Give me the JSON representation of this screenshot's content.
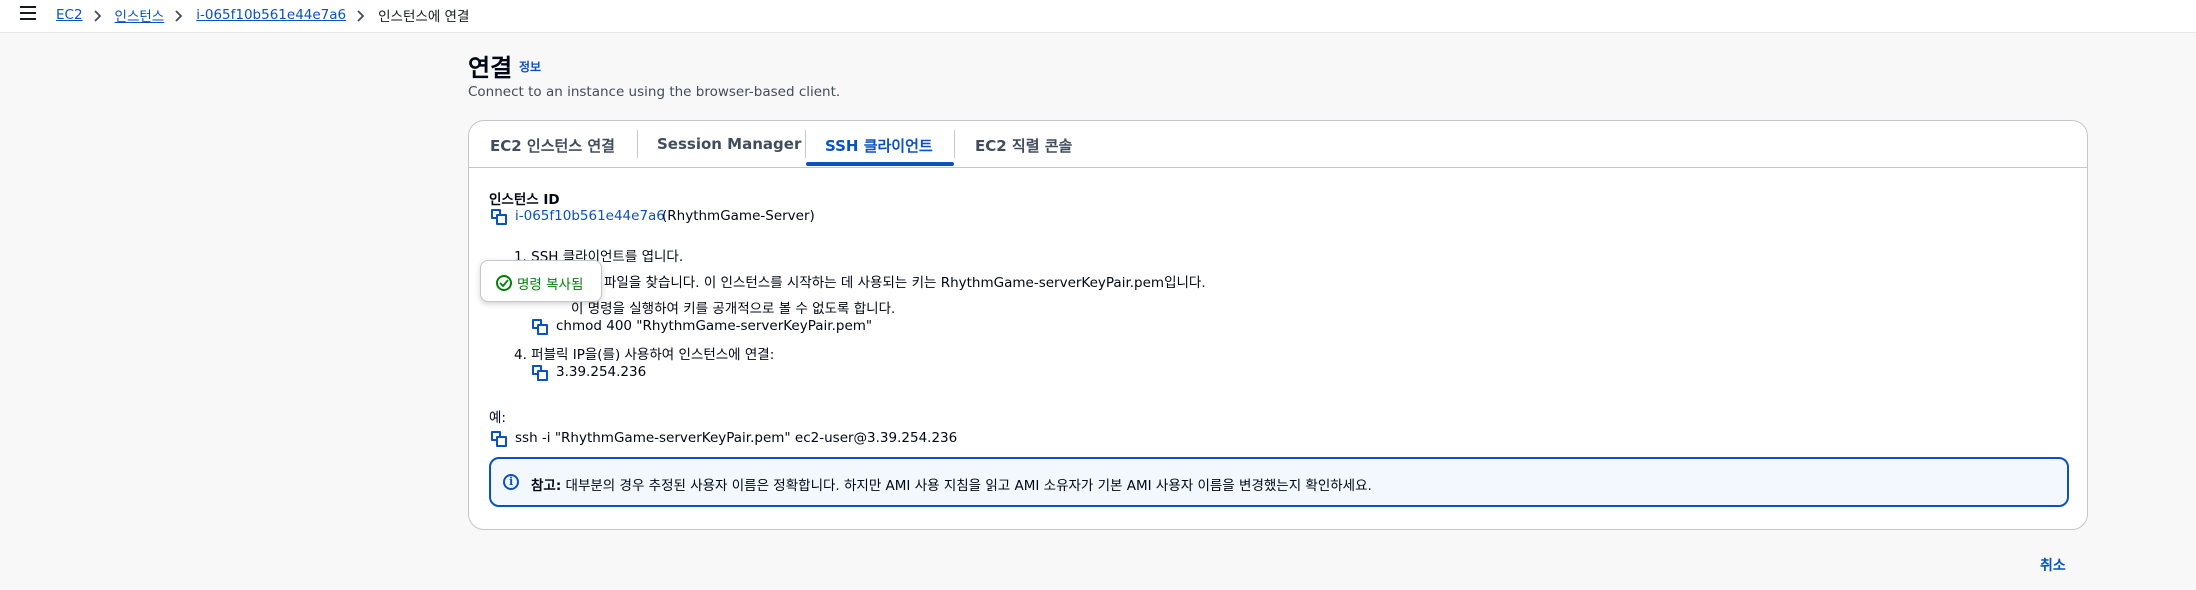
{
  "breadcrumb": {
    "items": [
      "EC2",
      "인스턴스",
      "i-065f10b561e44e7a6"
    ],
    "current": "인스턴스에 연결"
  },
  "header": {
    "title": "연결",
    "info": "정보",
    "subtitle": "Connect to an instance using the browser-based client."
  },
  "tabs": [
    {
      "label": "EC2 인스턴스 연결",
      "active": false
    },
    {
      "label": "Session Manager",
      "active": false
    },
    {
      "label": "SSH 클라이언트",
      "active": true
    },
    {
      "label": "EC2 직렬 콘솔",
      "active": false
    }
  ],
  "instance": {
    "heading": "인스턴스 ID",
    "id": "i-065f10b561e44e7a6",
    "name": "(RhythmGame-Server)"
  },
  "steps": {
    "s1": "1. SSH 클라이언트를 엽니다.",
    "s2": "파일을 찾습니다. 이 인스턴스를 시작하는 데 사용되는 키는 RhythmGame-serverKeyPair.pem입니다.",
    "s3": "이 명령을 실행하여 키를 공개적으로 볼 수 없도록 합니다.",
    "s3_cmd": "chmod 400 \"RhythmGame-serverKeyPair.pem\"",
    "s4": "4. 퍼블릭 IP을(를) 사용하여 인스턴스에 연결:",
    "s4_ip": "3.39.254.236"
  },
  "example": {
    "label": "예:",
    "command": "ssh -i \"RhythmGame-serverKeyPair.pem\" ec2-user@3.39.254.236"
  },
  "alert": {
    "bold": "참고:",
    "text": "대부분의 경우 추정된 사용자 이름은 정확합니다. 하지만 AMI 사용 지침을 읽고 AMI 소유자가 기본 AMI 사용자 이름을 변경했는지 확인하세요."
  },
  "popover": {
    "text": "명령 복사됨"
  },
  "footer": {
    "cancel": "취소"
  },
  "colors": {
    "link": "#0a52c2",
    "success": "#037f0c",
    "border": "#c6c6cd"
  }
}
